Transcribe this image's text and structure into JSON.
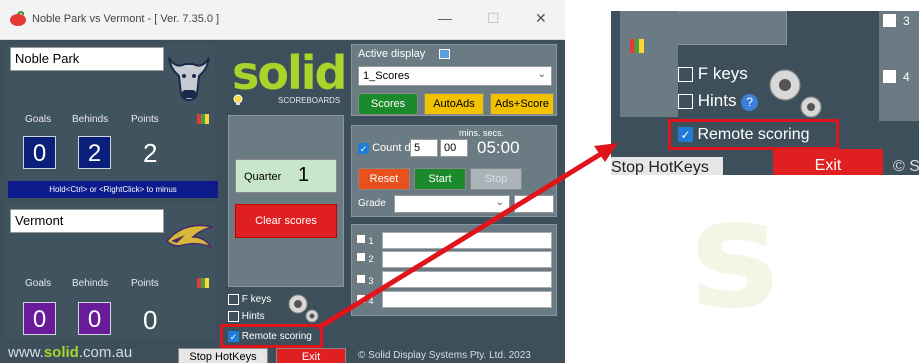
{
  "window": {
    "title": "Noble Park vs Vermont - [ Ver. 7.35.0 ]",
    "controls": {
      "minimize": "—",
      "maximize": "☐",
      "close": "✕"
    }
  },
  "home": {
    "name": "Noble Park",
    "labels": {
      "goals": "Goals",
      "behinds": "Behinds",
      "points": "Points"
    },
    "goals": "0",
    "behinds": "2",
    "points": "2",
    "color": "#0a1f7a"
  },
  "away": {
    "name": "Vermont",
    "labels": {
      "goals": "Goals",
      "behinds": "Behinds",
      "points": "Points"
    },
    "goals": "0",
    "behinds": "0",
    "points": "0",
    "color": "#6a1b9a"
  },
  "hint": "Hold<Ctrl> or <RightClick> to minus",
  "logo": {
    "word": "solid",
    "sub": "SCOREBOARDS"
  },
  "quarter": {
    "label": "Quarter",
    "value": "1"
  },
  "clear_scores": "Clear scores",
  "options": {
    "fkeys": "F keys",
    "hints": "Hints",
    "remote": "Remote scoring"
  },
  "footer": {
    "url_prefix": "www.",
    "url_brand": "solid",
    "url_suffix": ".com.au",
    "stop_hotkeys": "Stop HotKeys",
    "exit": "Exit",
    "copyright": "© Solid Display Systems Pty. Ltd. 2023"
  },
  "display": {
    "label": "Active display",
    "selected": "1_Scores",
    "buttons": {
      "scores": "Scores",
      "autoads": "AutoAds",
      "adsscore": "Ads+Score"
    }
  },
  "timer": {
    "countdown_label": "Count down",
    "mins_secs_label": "mins. secs.",
    "mins": "5",
    "secs": "00",
    "display": "05:00",
    "reset": "Reset",
    "start": "Start",
    "stop": "Stop"
  },
  "grade": {
    "label": "Grade"
  },
  "lines": [
    "1",
    "2",
    "3",
    "4"
  ],
  "zoom": {
    "fkeys": "F keys",
    "hints": "Hints",
    "remote": "Remote scoring",
    "stop_hotkeys": "Stop HotKeys",
    "exit": "Exit",
    "copyright_fragment": "© S",
    "line_fragments": [
      "3",
      "4"
    ]
  },
  "colors": {
    "accent_red": "#e02020",
    "green_button": "#1b8a2a",
    "brand_green": "#a8d42c",
    "highlight": "#e0151b"
  }
}
